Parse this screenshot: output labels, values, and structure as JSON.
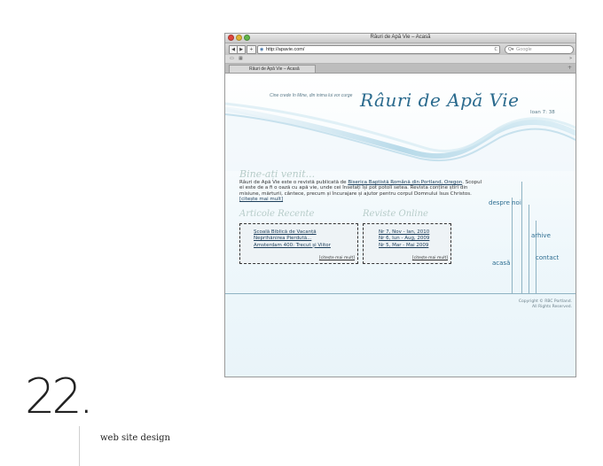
{
  "window": {
    "title": "Râuri de Apă Vie – Acasă",
    "url": "http://apavie.com/",
    "search_placeholder": "Google",
    "tab_label": "Râuri de Apă Vie – Acasă"
  },
  "site": {
    "motto": "Cine crede în Mine, din inima lui vor curge",
    "logo": "Râuri de Apă Vie",
    "verse_ref": "Ioan 7: 38",
    "welcome_heading": "Bine-ați venit...",
    "intro_prefix": "Râuri de Apă Vie este o revistă publicată de ",
    "intro_link": "Biserica Baptistă Română din Portland, Oregon",
    "intro_text": ". Scopul ei este de a fi o oază cu apă vie, unde cei însetați își pot potoli setea. Revista conține știri din misiune, mărturii, cântece, precum și încurajare și ajutor pentru corpul Domnului Isus Christos. ",
    "intro_more": "[citește mai mult]",
    "articles_heading": "Articole Recente",
    "articles": [
      "Școală Biblică de Vacanță",
      "Neprihănirea Pierdută...",
      "Amsterdam 400: Trecut și Viitor"
    ],
    "articles_more": "[citește mai mult]",
    "magazines_heading": "Reviste Online",
    "magazines": [
      "Nr 7, Nov - Ian, 2010",
      "Nr 6, Iun - Aug, 2009",
      "Nr 5, Mar - Mai 2009"
    ],
    "magazines_more": "[citește mai mult]",
    "nav": {
      "about": "despre noi",
      "archive": "arhive",
      "home": "acasă",
      "contact": "contact"
    },
    "copyright_1": "Copyright © RBC Portland.",
    "copyright_2": "All Rights Reserved."
  },
  "caption": {
    "number": "22.",
    "text": "web site design"
  },
  "colors": {
    "accent": "#2a6a8d",
    "heading_script": "#b7ccc9",
    "lines": "#8fb3c3"
  },
  "icons": [
    "close-icon",
    "minimize-icon",
    "zoom-icon",
    "back-arrow-icon",
    "forward-arrow-icon",
    "add-bookmark-icon",
    "globe-icon",
    "reload-icon",
    "search-icon",
    "book-icon",
    "grid-icon",
    "chevron-icon"
  ]
}
